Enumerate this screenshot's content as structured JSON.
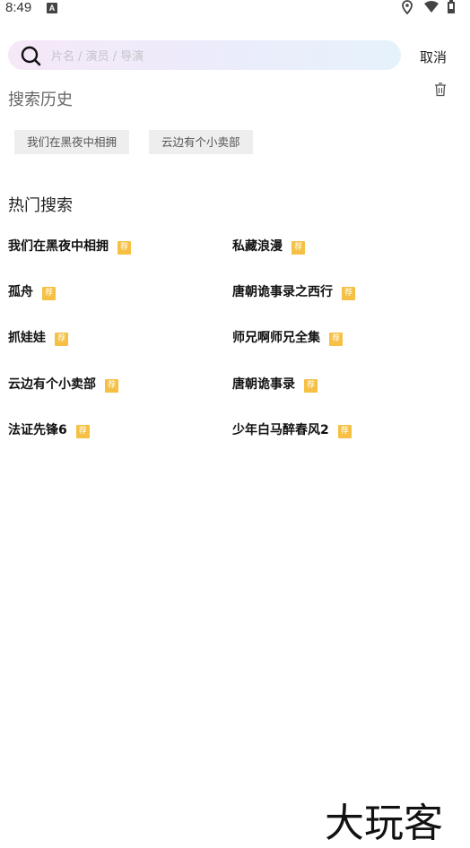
{
  "status_bar": {
    "time": "8:49",
    "notification_icon": "A"
  },
  "search": {
    "placeholder": "片名 / 演员 / 导演",
    "value": "",
    "cancel_label": "取消"
  },
  "history": {
    "title": "搜索历史",
    "items": [
      "我们在黑夜中相拥",
      "云边有个小卖部"
    ]
  },
  "hot": {
    "title": "热门搜索",
    "badge": "荐",
    "items": [
      "我们在黑夜中相拥",
      "私藏浪漫",
      "孤舟",
      "唐朝诡事录之西行",
      "抓娃娃",
      "师兄啊师兄全集",
      "云边有个小卖部",
      "唐朝诡事录",
      "法证先锋6",
      "少年白马醉春风2"
    ]
  },
  "watermark": "大玩客",
  "colors": {
    "badge": "#f5c043",
    "search_gradient_start": "#f6e8f7",
    "search_gradient_end": "#e6f2fb",
    "tag_bg": "#eeeeee"
  }
}
